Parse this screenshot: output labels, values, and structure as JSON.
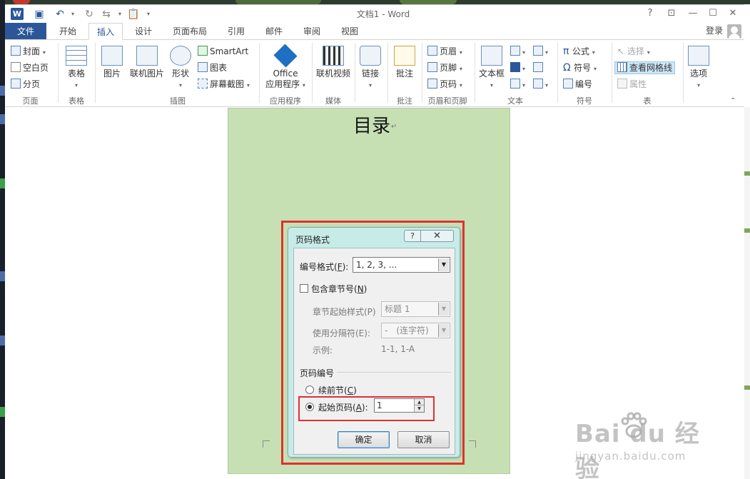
{
  "window": {
    "title": "文档1 - Word",
    "help": "?",
    "restore_ribbon": "⊡",
    "minimize": "—",
    "maximize": "☐",
    "close": "✕",
    "app_logo": "W"
  },
  "qat": {
    "save_icon": "save-icon",
    "undo_icon": "undo-icon",
    "redo_icon": "redo-icon",
    "paste_icon": "paste-icon"
  },
  "tabs": {
    "file": "文件",
    "items": [
      "开始",
      "插入",
      "设计",
      "页面布局",
      "引用",
      "邮件",
      "审阅",
      "视图"
    ],
    "active": "插入",
    "login": "登录"
  },
  "ribbon": {
    "groups": {
      "page": {
        "label": "页面",
        "cover": "封面",
        "blank": "空白页",
        "break": "分页"
      },
      "table": {
        "label": "表格",
        "table": "表格"
      },
      "illustrations": {
        "label": "插图",
        "picture": "图片",
        "online_picture": "联机图片",
        "shapes": "形状",
        "smartart": "SmartArt",
        "chart": "图表",
        "screenshot": "屏幕截图"
      },
      "apps": {
        "label": "应用程序",
        "office": "Office",
        "office2": "应用程序"
      },
      "media": {
        "label": "媒体",
        "online_video": "联机视频"
      },
      "links": {
        "link": "链接"
      },
      "comments": {
        "label": "批注",
        "comment": "批注"
      },
      "header_footer": {
        "label": "页眉和页脚",
        "header": "页眉",
        "footer": "页脚",
        "page_number": "页码"
      },
      "text": {
        "label": "文本",
        "textbox": "文本框"
      },
      "symbols": {
        "label": "符号",
        "equation": "公式",
        "symbol": "符号",
        "number": "编号"
      },
      "tables2": {
        "label": "表",
        "select": "选择",
        "gridlines": "查看网格线",
        "properties": "属性"
      },
      "options": {
        "options": "选项"
      }
    }
  },
  "document": {
    "heading": "目录",
    "para_mark": "↵"
  },
  "dialog": {
    "title": "页码格式",
    "help": "?",
    "close": "✕",
    "number_format_label": "编号格式(",
    "number_format_key": "F",
    "number_format_close": "):",
    "number_format_value": "1, 2, 3, ...",
    "include_chapter_label": "包含章节号(",
    "include_chapter_key": "N",
    "include_chapter_close": ")",
    "include_chapter_checked": false,
    "chapter_style_label": "章节起始样式(P)",
    "chapter_style_value": "标题 1",
    "separator_label": "使用分隔符(E):",
    "separator_value": "-　(连字符)",
    "example_label": "示例:",
    "example_value": "1-1, 1-A",
    "numbering_section": "页码编号",
    "continue_label": "续前节(",
    "continue_key": "C",
    "continue_close": ")",
    "start_at_label": "起始页码(",
    "start_at_key": "A",
    "start_at_close": "):",
    "start_at_value": "1",
    "selected_option": "start_at",
    "ok": "确定",
    "cancel": "取消"
  },
  "watermark": {
    "main": "Bai  du 经验",
    "sub": "jingyan.baidu.com"
  },
  "colors": {
    "word_blue": "#2b579a",
    "page_green": "#c6e0b4",
    "dialog_teal": "#c7ece8",
    "highlight_red": "#e03030"
  }
}
